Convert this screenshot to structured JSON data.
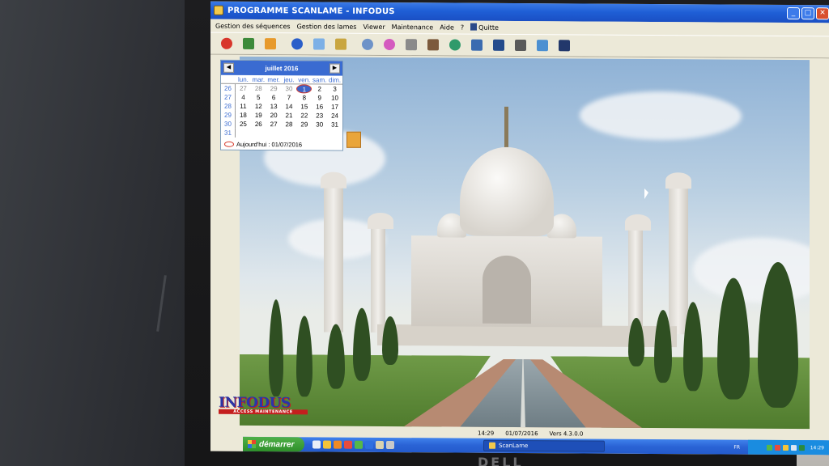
{
  "window": {
    "title": "PROGRAMME SCANLAME - INFODUS"
  },
  "menu": {
    "items": [
      "Gestion des séquences",
      "Gestion des lames",
      "Viewer",
      "Maintenance",
      "Aide",
      "?"
    ],
    "quit_label": "Quitte"
  },
  "toolbar": {
    "icons": [
      "power-icon",
      "layers-icon",
      "list-icon",
      "play-icon",
      "image-stack-icon",
      "puzzle-icon",
      "scan-icon",
      "color-icon",
      "wrench-icon",
      "slide-icon",
      "globe-icon",
      "tools-icon",
      "close-tools-icon",
      "calculator-icon",
      "search-image-icon",
      "exit-icon"
    ]
  },
  "calendar": {
    "month_label": "juillet 2016",
    "prev": "◀",
    "next": "▶",
    "day_names": [
      "lun.",
      "mar.",
      "mer.",
      "jeu.",
      "ven.",
      "sam.",
      "dim."
    ],
    "weeks": [
      "26",
      "27",
      "28",
      "29",
      "30",
      "31"
    ],
    "rows": [
      [
        "27",
        "28",
        "29",
        "30",
        "1",
        "2",
        "3"
      ],
      [
        "4",
        "5",
        "6",
        "7",
        "8",
        "9",
        "10"
      ],
      [
        "11",
        "12",
        "13",
        "14",
        "15",
        "16",
        "17"
      ],
      [
        "18",
        "19",
        "20",
        "21",
        "22",
        "23",
        "24"
      ],
      [
        "25",
        "26",
        "27",
        "28",
        "29",
        "30",
        "31"
      ]
    ],
    "today_label": "Aujourd'hui : 01/07/2016"
  },
  "logo": {
    "name": "INFODUS",
    "tagline": "ACCESS MAINTENANCE"
  },
  "status": {
    "time": "14:29",
    "date": "01/07/2016",
    "version": "Vers 4.3.0.0"
  },
  "taskbar": {
    "start_label": "démarrer",
    "task_label": "ScanLame",
    "lang": "FR",
    "clock": "14:29"
  },
  "screen_brand": "DELL",
  "colors": {
    "titlebar": "#1f5fd6",
    "accent": "#3a6bd1",
    "logo_red": "#c41e1e"
  }
}
